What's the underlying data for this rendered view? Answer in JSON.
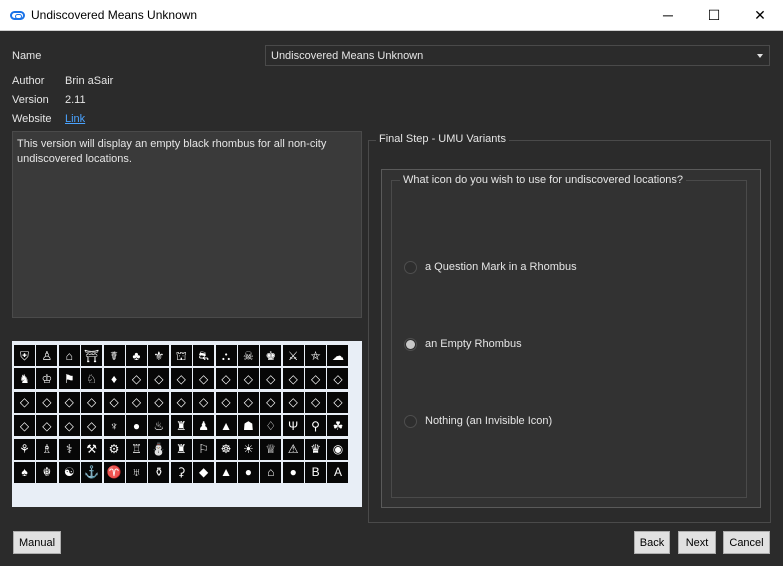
{
  "window": {
    "title": "Undiscovered Means Unknown",
    "minimize_icon": "─",
    "maximize_icon": "☐",
    "close_icon": "✕"
  },
  "info": {
    "name_label": "Name",
    "name_value": "Undiscovered Means Unknown",
    "author_label": "Author",
    "author_value": "Brin aSair",
    "version_label": "Version",
    "version_value": "2.11",
    "website_label": "Website",
    "website_link": "Link"
  },
  "description": "This version will display an empty black rhombus for all non-city undiscovered locations.",
  "preview_icons": [
    "⛨",
    "♙",
    "⌂",
    "⛩",
    "☤",
    "♣",
    "⚜",
    "⛫",
    "⛐",
    "⛬",
    "☠",
    "♚",
    "⚔",
    "⛤",
    "☁",
    "♞",
    "♔",
    "⚑",
    "♘",
    "♦",
    "◇",
    "◇",
    "◇",
    "◇",
    "◇",
    "◇",
    "◇",
    "◇",
    "◇",
    "◇",
    "◇",
    "◇",
    "◇",
    "◇",
    "◇",
    "◇",
    "◇",
    "◇",
    "◇",
    "◇",
    "◇",
    "◇",
    "◇",
    "◇",
    "◇",
    "◇",
    "◇",
    "◇",
    "◇",
    "♆",
    "●",
    "♨",
    "♜",
    "♟",
    "▲",
    "☗",
    "♢",
    "Ψ",
    "⚲",
    "☘",
    "⚘",
    "♗",
    "⚕",
    "⚒",
    "⚙",
    "♖",
    "⛄",
    "♜",
    "⚐",
    "☸",
    "☀",
    "♕",
    "⚠",
    "♛",
    "◉",
    "♠",
    "☬",
    "☯",
    "⚓",
    "♈",
    "♅",
    "⚱",
    "⚳",
    "◆",
    "▲",
    "●",
    "⌂",
    "●",
    "B",
    "A"
  ],
  "variants": {
    "group_title": "Final Step - UMU Variants",
    "question": "What icon do you wish to use for undiscovered locations?",
    "options": [
      "a Question Mark in a Rhombus",
      "an Empty Rhombus",
      "Nothing (an Invisible Icon)"
    ],
    "selected_index": 1
  },
  "buttons": {
    "manual": "Manual",
    "back": "Back",
    "next": "Next",
    "cancel": "Cancel"
  },
  "colors": {
    "background": "#2b2b2b",
    "text": "#e6e6e6",
    "link": "#4aa3ff",
    "accent": "#1a73e8"
  }
}
